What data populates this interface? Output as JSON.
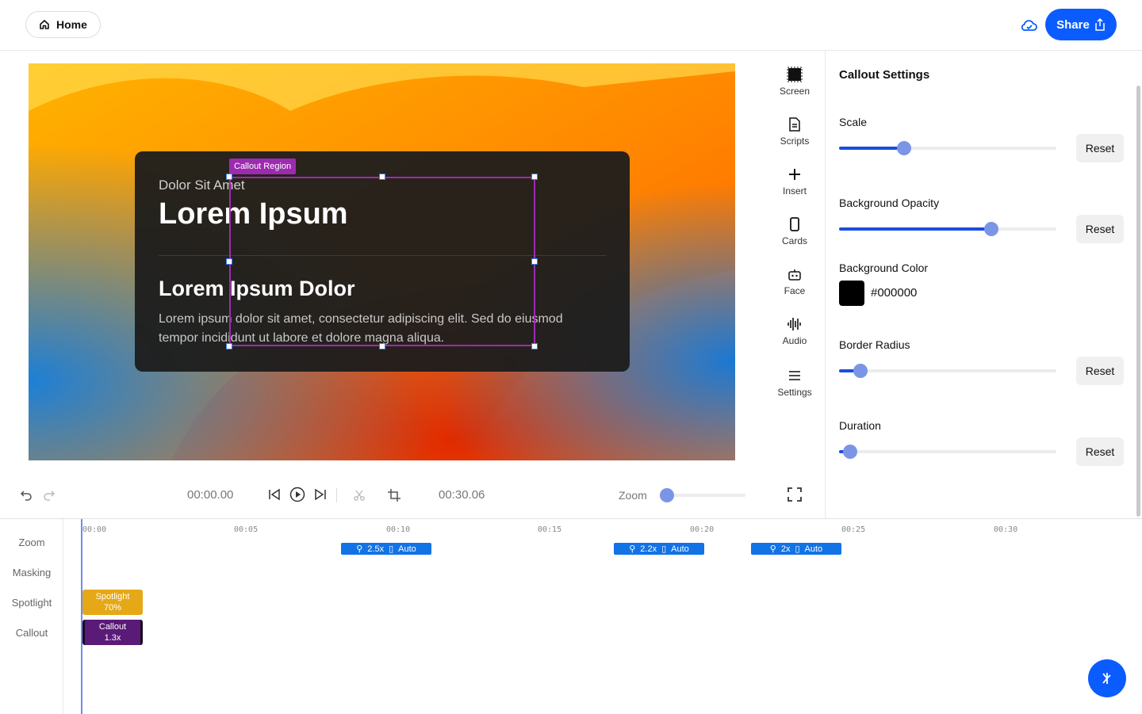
{
  "topbar": {
    "home_label": "Home",
    "share_label": "Share"
  },
  "canvas": {
    "card": {
      "subtitle": "Dolor Sit Amet",
      "title": "Lorem Ipsum",
      "heading": "Lorem Ipsum Dolor",
      "body": "Lorem ipsum dolor sit amet, consectetur adipiscing elit. Sed do eiusmod tempor incididunt ut labore et dolore magna aliqua."
    },
    "region_label": "Callout Region"
  },
  "tools": [
    {
      "label": "Screen",
      "icon": "screen-icon"
    },
    {
      "label": "Scripts",
      "icon": "document-icon"
    },
    {
      "label": "Insert",
      "icon": "plus-icon"
    },
    {
      "label": "Cards",
      "icon": "card-icon"
    },
    {
      "label": "Face",
      "icon": "robot-icon"
    },
    {
      "label": "Audio",
      "icon": "waveform-icon"
    },
    {
      "label": "Settings",
      "icon": "menu-icon"
    }
  ],
  "panel": {
    "title": "Callout Settings",
    "reset_label": "Reset",
    "scale": {
      "label": "Scale",
      "value": 0.3
    },
    "opacity": {
      "label": "Background Opacity",
      "value": 0.7
    },
    "color": {
      "label": "Background Color",
      "value": "#000000"
    },
    "radius": {
      "label": "Border Radius",
      "value": 0.1
    },
    "duration": {
      "label": "Duration",
      "value": 0.05
    }
  },
  "playback": {
    "current_time": "00:00.00",
    "total_time": "00:30.06",
    "zoom_label": "Zoom",
    "zoom_value": 0.0
  },
  "timeline": {
    "tracks": [
      "Zoom",
      "Masking",
      "Spotlight",
      "Callout"
    ],
    "ticks": [
      "00:00",
      "00:05",
      "00:10",
      "00:15",
      "00:20",
      "00:25",
      "00:30"
    ],
    "zoom_clips": [
      {
        "scale": "2.5x",
        "mode": "Auto"
      },
      {
        "scale": "2.2x",
        "mode": "Auto"
      },
      {
        "scale": "2x",
        "mode": "Auto"
      }
    ],
    "spotlight_clip": {
      "name": "Spotlight",
      "value": "70%"
    },
    "callout_clip": {
      "name": "Callout",
      "value": "1.3x"
    }
  },
  "colors": {
    "accent": "#0b5cff",
    "region": "#9d2bb0",
    "spotlight": "#e6a817",
    "callout": "#5a1a78",
    "zoom_clip": "#1173e6"
  }
}
